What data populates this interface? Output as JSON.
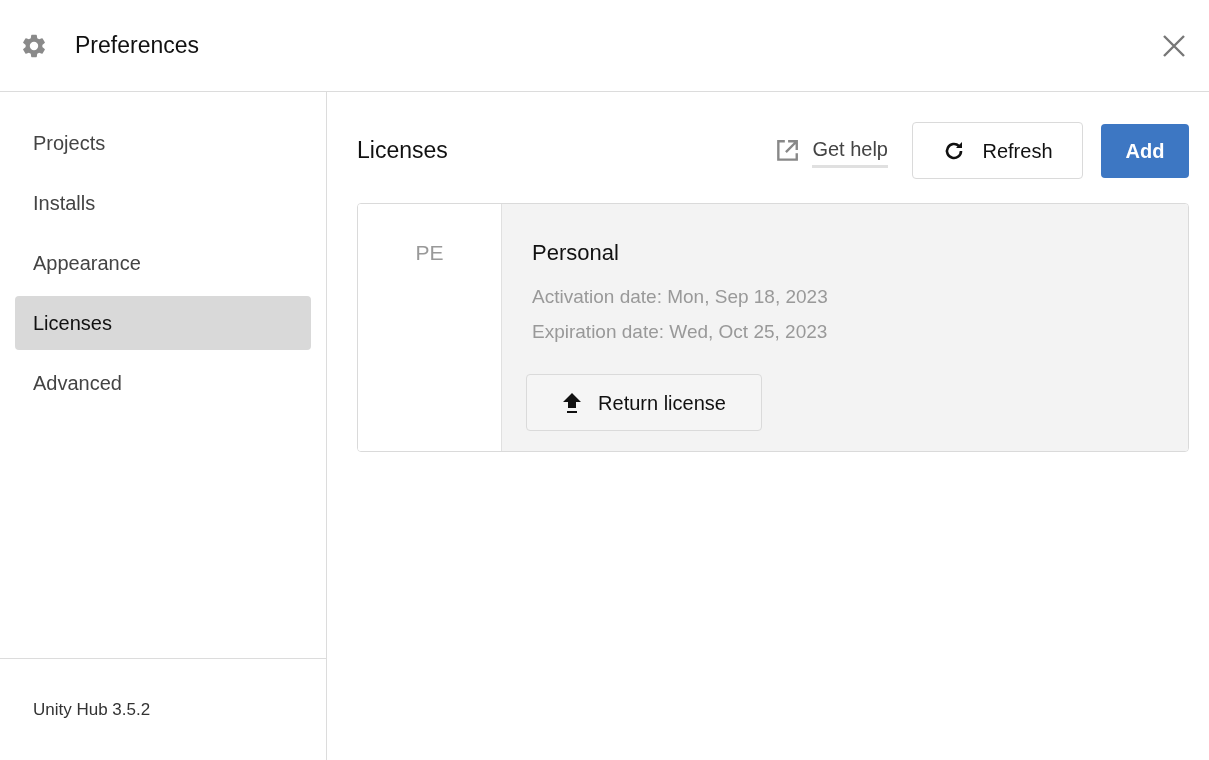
{
  "window": {
    "title": "Preferences"
  },
  "sidebar": {
    "items": [
      {
        "label": "Projects",
        "selected": false
      },
      {
        "label": "Installs",
        "selected": false
      },
      {
        "label": "Appearance",
        "selected": false
      },
      {
        "label": "Licenses",
        "selected": true
      },
      {
        "label": "Advanced",
        "selected": false
      }
    ],
    "version": "Unity Hub 3.5.2"
  },
  "content": {
    "heading": "Licenses",
    "help_link": "Get help",
    "refresh_button": "Refresh",
    "add_button": "Add",
    "licenses": [
      {
        "badge": "PE",
        "name": "Personal",
        "activation": "Activation date: Mon, Sep 18, 2023",
        "expiration": "Expiration date: Wed, Oct 25, 2023",
        "return_button": "Return license"
      }
    ]
  }
}
